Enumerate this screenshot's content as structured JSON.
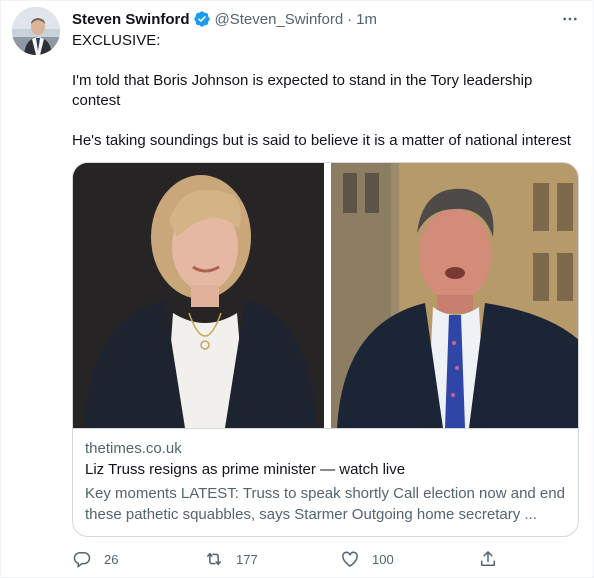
{
  "tweet": {
    "author_name": "Steven Swinford",
    "handle": "@Steven_Swinford",
    "separator": "·",
    "time": "1m",
    "lines": [
      "EXCLUSIVE:",
      "I'm told that Boris Johnson is expected to stand in the Tory leadership contest",
      "He's taking soundings but is said to believe it is a matter of national interest"
    ]
  },
  "card": {
    "domain": "thetimes.co.uk",
    "title": "Liz Truss resigns as prime minister — watch live",
    "description": "Key moments LATEST: Truss to speak shortly Call election now and end these pathetic squabbles, says Starmer Outgoing home secretary ..."
  },
  "actions": {
    "reply_count": "26",
    "retweet_count": "177",
    "like_count": "100"
  },
  "icons": {
    "verified": "verified-badge-icon",
    "more": "more-icon",
    "reply": "reply-icon",
    "retweet": "retweet-icon",
    "like": "like-icon",
    "share": "share-icon"
  },
  "colors": {
    "verified": "#1d9bf0",
    "secondary_text": "#536471",
    "primary_text": "#0f1419",
    "border": "#cfd9de"
  }
}
